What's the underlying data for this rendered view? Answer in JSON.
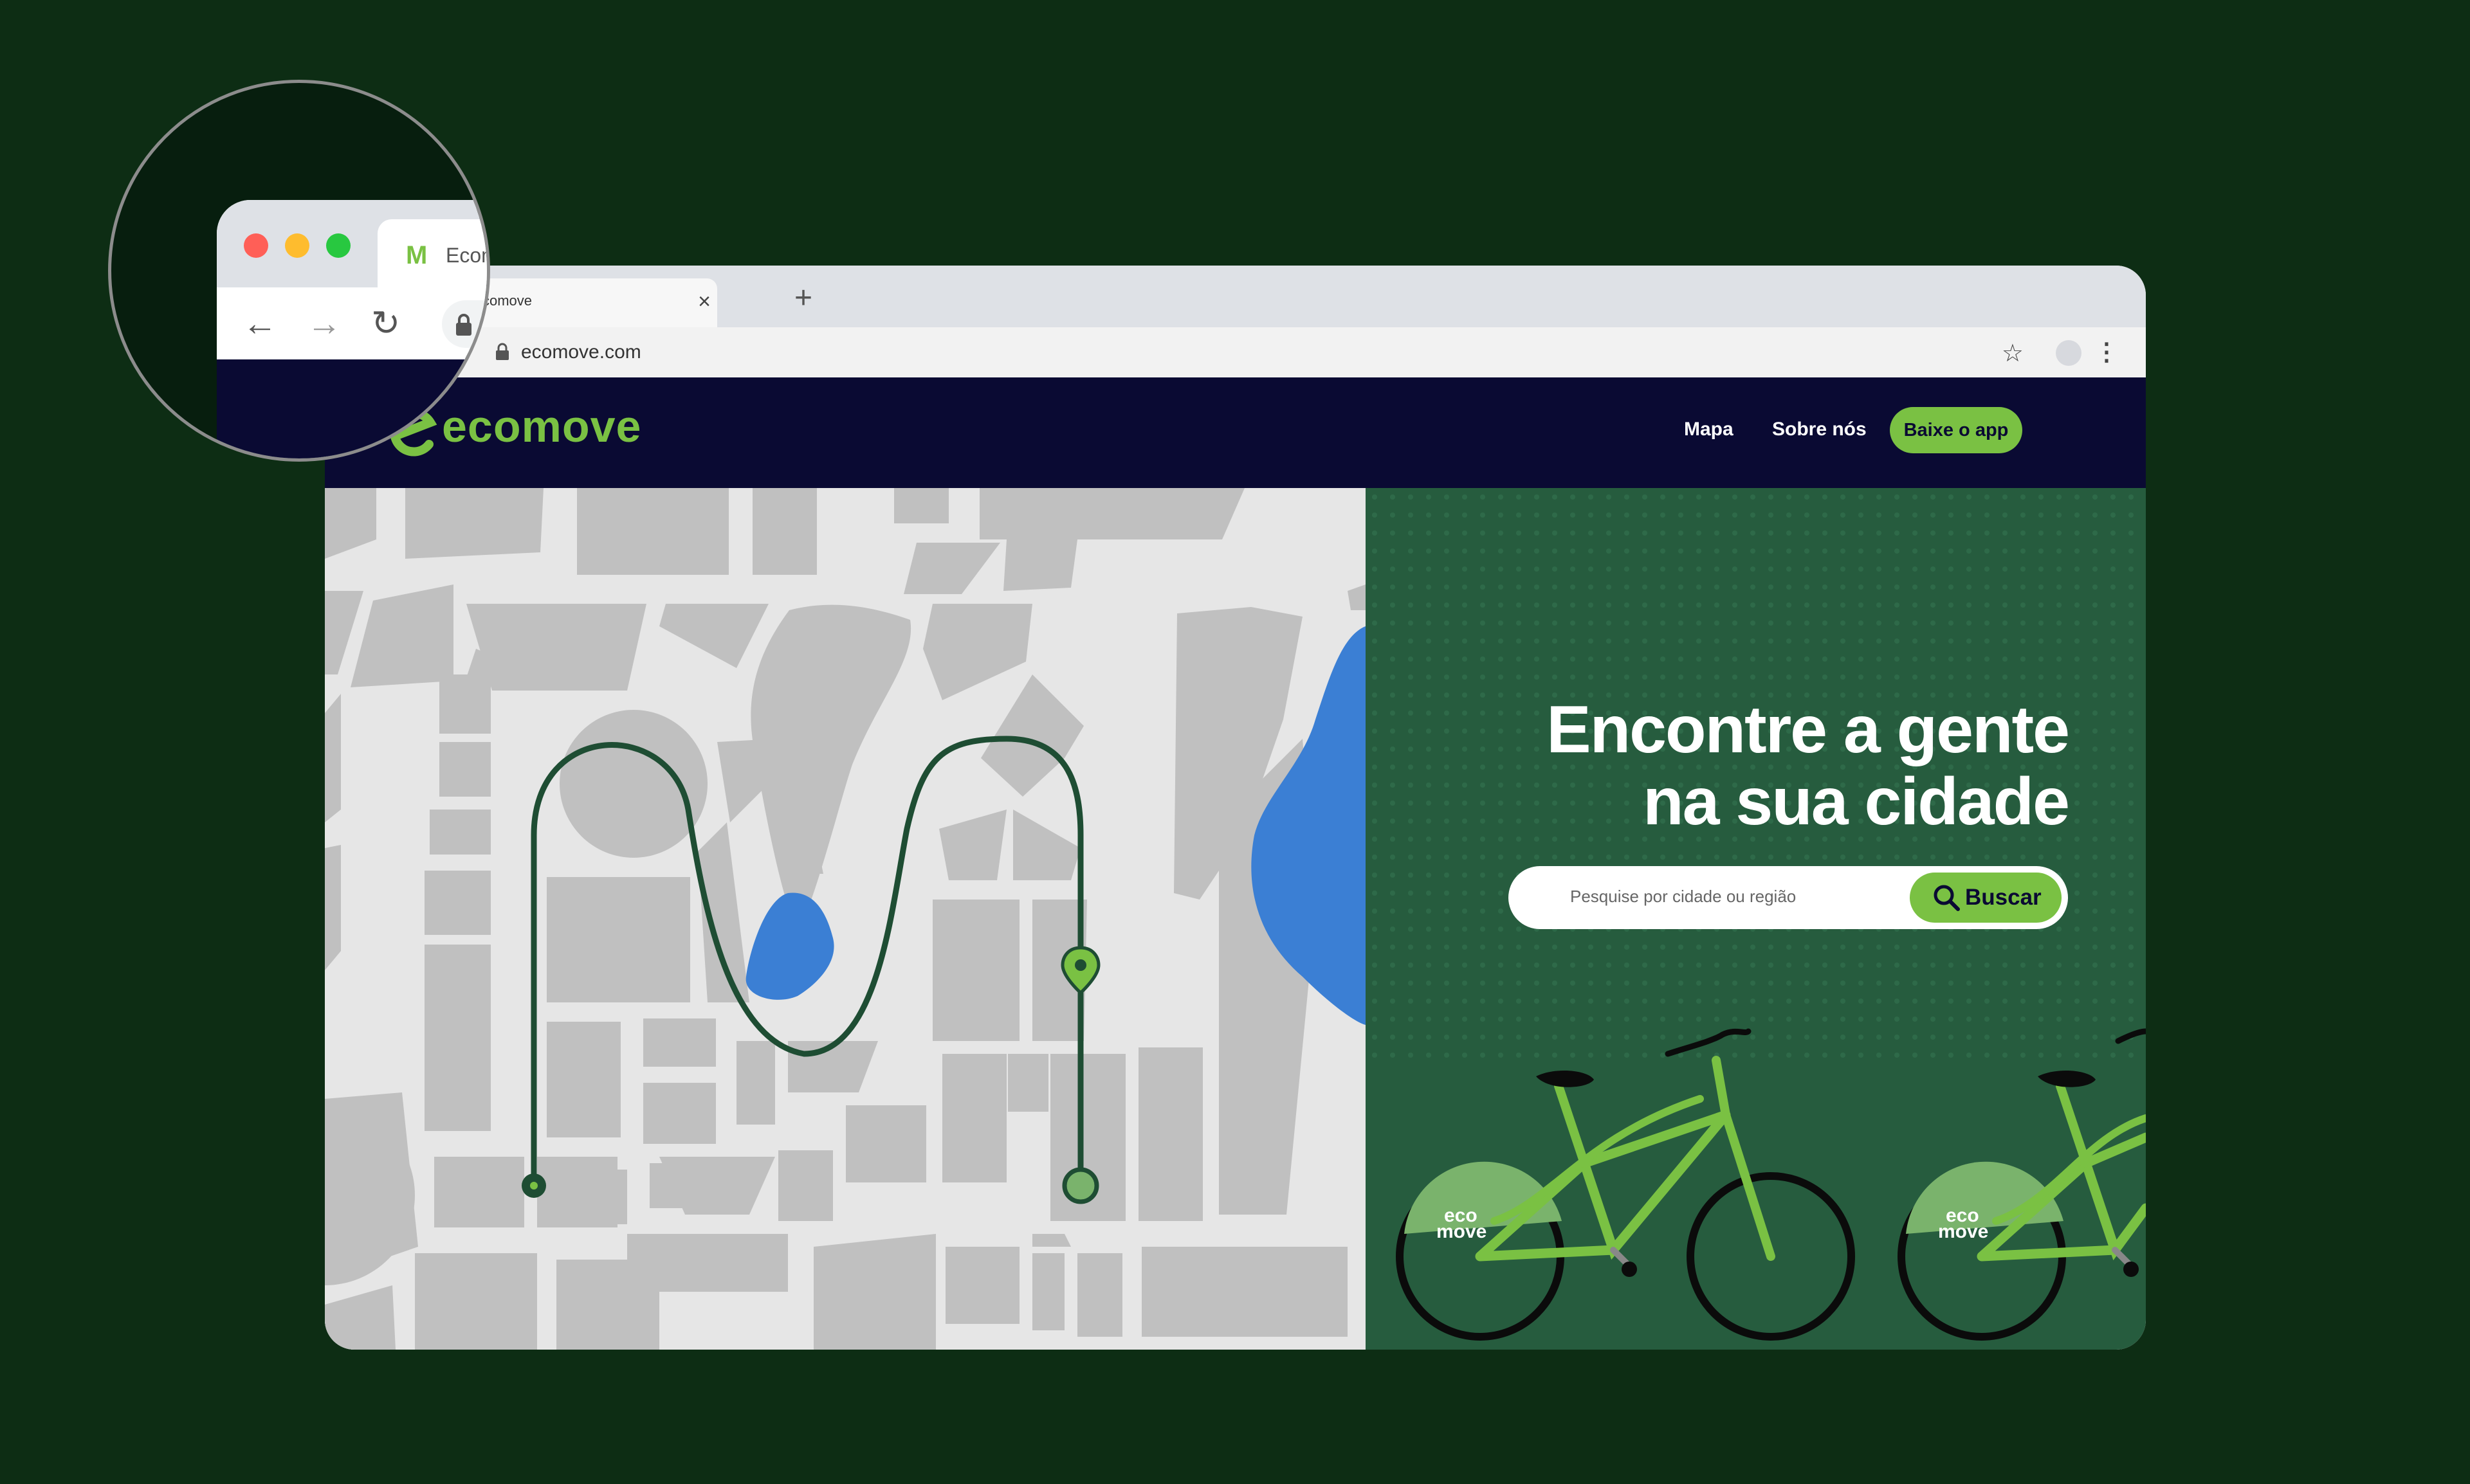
{
  "browser": {
    "tab_title": "Ecomove",
    "tab_title_partial": "comove",
    "tab_close": "×",
    "new_tab": "+",
    "url": "ecomove.com",
    "star_icon": "☆",
    "menu_icon": "⋮",
    "magnified_tab_title": "Ecom",
    "favicon": "M",
    "back_icon": "←",
    "forward_icon": "→",
    "reload_icon": "↻",
    "traffic_lights": [
      "#ff5f57",
      "#febc2e",
      "#28c840"
    ]
  },
  "site": {
    "logo": "ecomove",
    "nav": {
      "map": "Mapa",
      "about": "Sobre nós",
      "download": "Baixe o app"
    },
    "hero": {
      "line1": "Encontre a gente",
      "line2": "na sua cidade",
      "search_placeholder": "Pesquise por cidade ou região",
      "search_button": "Buscar"
    },
    "bike_brand_line1": "eco",
    "bike_brand_line2": "move"
  },
  "colors": {
    "background": "#0d2d14",
    "brand_green": "#7ac143",
    "navbar": "#0a0a33",
    "hero": "#265c3e",
    "water": "#3b7fd4",
    "route": "#1e4d33"
  }
}
